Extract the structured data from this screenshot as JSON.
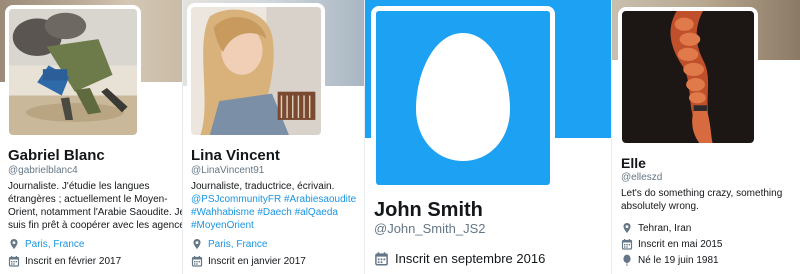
{
  "colors": {
    "link": "#1b95e0",
    "muted": "#657786",
    "text": "#14171a",
    "banner_blue": "#1da1f2",
    "egg_bg": "#1da1f2"
  },
  "profiles": [
    {
      "name": "Gabriel Blanc",
      "handle": "@gabrielblanc4",
      "bio_lines": [
        "Journaliste. J'étudie les langues",
        "étrangères ; actuellement le Moyen-",
        "Orient, notamment l'Arabie Saoudite. Je",
        "suis fin prêt à coopérer avec les agences."
      ],
      "location": "Paris, France",
      "joined": "Inscrit en février 2017",
      "location_icon": "location-pin-icon",
      "joined_icon": "calendar-icon"
    },
    {
      "name": "Lina Vincent",
      "handle": "@LinaVincent91",
      "bio_lines": [
        "Journaliste, traductrice, écrivain.",
        "@PSJcommunityFR #Arabiesaoudite",
        "#Wahhabisme #Daech #alQaeda",
        "#MoyenOrient"
      ],
      "location": "Paris, France",
      "joined": "Inscrit en janvier 2017",
      "location_icon": "location-pin-icon",
      "joined_icon": "calendar-icon"
    },
    {
      "name": "John Smith",
      "handle": "@John_Smith_JS2",
      "joined": "Inscrit en septembre 2016",
      "joined_icon": "calendar-icon",
      "avatar_icon": "default-egg-icon"
    },
    {
      "name": "Elle",
      "handle": "@elleszd",
      "bio_lines": [
        "Let's do something crazy, something",
        "absolutely wrong."
      ],
      "location": "Tehran, Iran",
      "joined": "Inscrit en mai 2015",
      "born": "Né le 19 juin 1981",
      "location_icon": "location-pin-icon",
      "joined_icon": "calendar-icon",
      "born_icon": "balloon-icon"
    }
  ]
}
